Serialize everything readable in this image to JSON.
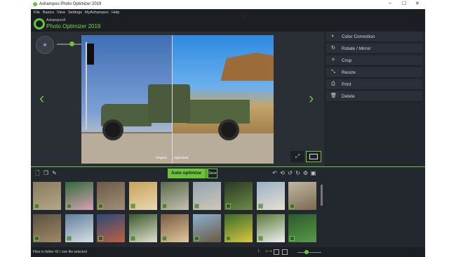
{
  "window": {
    "title": "Ashampoo Photo Optimizer 2019",
    "controls": {
      "minimize": "–",
      "maximize": "☐",
      "close": "✕"
    }
  },
  "menu": [
    "File",
    "Basics",
    "View",
    "Settings",
    "MyAshampoo",
    "Help"
  ],
  "brand": {
    "small": "Ashampoo®",
    "big": "Photo Optimizer 2019"
  },
  "viewer": {
    "label_original": "Original",
    "label_optimized": "Optimized",
    "nav_left": "‹",
    "nav_right": "›",
    "zoom_level": 0.35
  },
  "side_panel": [
    {
      "label": "Color Correction",
      "icon": "color-correction-icon",
      "glyph": "◐"
    },
    {
      "label": "Rotate / Mirror",
      "icon": "rotate-icon",
      "glyph": "↻"
    },
    {
      "label": "Crop",
      "icon": "crop-icon",
      "glyph": "⌗"
    },
    {
      "label": "Resize",
      "icon": "resize-icon",
      "glyph": "⤡"
    },
    {
      "label": "Print",
      "icon": "print-icon",
      "glyph": "⎙"
    },
    {
      "label": "Delete",
      "icon": "trash-icon",
      "glyph": "🗑"
    }
  ],
  "toolbar": {
    "auto_optimize": "Auto optimize",
    "save": "Save"
  },
  "thumbnails": [
    {
      "colors": [
        "#8a7a5a",
        "#b3a88c"
      ]
    },
    {
      "colors": [
        "#2f6b3a",
        "#d9a1b5"
      ]
    },
    {
      "colors": [
        "#6b5a48",
        "#a38e78"
      ]
    },
    {
      "colors": [
        "#c8a25a",
        "#e8d8b0"
      ]
    },
    {
      "colors": [
        "#5a6a4a",
        "#c6c0b2"
      ]
    },
    {
      "colors": [
        "#8fa3b0",
        "#d0c8b8"
      ]
    },
    {
      "colors": [
        "#2a3a22",
        "#6e8a4a"
      ]
    },
    {
      "colors": [
        "#9ab0c6",
        "#e6e0d0"
      ]
    },
    {
      "colors": [
        "#c0b8a0",
        "#7a6a50"
      ]
    },
    {
      "colors": [
        "#5a5040",
        "#a08a68"
      ]
    },
    {
      "colors": [
        "#5f7f9a",
        "#d8e0e6"
      ]
    },
    {
      "colors": [
        "#2a4a7a",
        "#c06040"
      ]
    },
    {
      "colors": [
        "#3a5a2a",
        "#e0e0d0"
      ]
    },
    {
      "colors": [
        "#7a5a40",
        "#e0c8a0"
      ]
    },
    {
      "colors": [
        "#8ab0d0",
        "#6a5a40"
      ]
    },
    {
      "colors": [
        "#3a6a2a",
        "#d8c840"
      ]
    },
    {
      "colors": [
        "#5a7a3a",
        "#f0f0f0"
      ]
    },
    {
      "colors": [
        "#2a5a2a",
        "#5a9a4a"
      ]
    }
  ],
  "status": {
    "text": "Files in folder 42 / one file selected"
  },
  "colors": {
    "accent": "#6ac33a",
    "background": "#23282f",
    "bar": "#1b1f24"
  }
}
